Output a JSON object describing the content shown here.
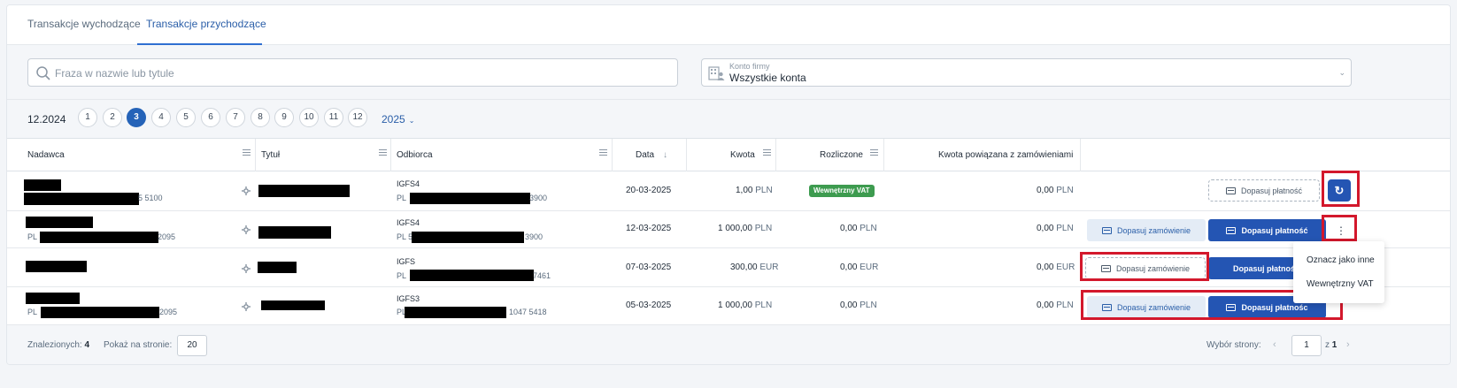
{
  "tabs": [
    {
      "label": "Transakcje wychodzące"
    },
    {
      "label": "Transakcje przychodzące"
    }
  ],
  "search": {
    "placeholder": "Fraza w nazwie lub tytule"
  },
  "account": {
    "label": "Konto firmy",
    "value": "Wszystkie konta"
  },
  "months": {
    "period": "12.2024",
    "items": [
      "1",
      "2",
      "3",
      "4",
      "5",
      "6",
      "7",
      "8",
      "9",
      "10",
      "11",
      "12"
    ],
    "selected": "3",
    "year": "2025"
  },
  "columns": {
    "sender": "Nadawca",
    "title": "Tytuł",
    "recipient": "Odbiorca",
    "date": "Data",
    "amount": "Kwota",
    "settled": "Rozliczone",
    "linked": "Kwota powiązana z zamówieniami"
  },
  "rows": [
    {
      "sender_suffix": "5 5100",
      "recipient_name": "IGFS4",
      "recipient_prefix": "PL",
      "recipient_suffix": "3900",
      "date": "20-03-2025",
      "amount": "1,00",
      "amount_currency": "PLN",
      "settled_badge": "Wewnętrzny VAT",
      "linked": "0,00",
      "linked_currency": "PLN",
      "pay_button": "Dopasuj płatność"
    },
    {
      "sender_prefix": "PL",
      "sender_suffix": "2095",
      "recipient_name": "IGFS4",
      "recipient_prefix": "PL 5",
      "recipient_suffix": "3900",
      "date": "12-03-2025",
      "amount": "1 000,00",
      "amount_currency": "PLN",
      "settled": "0,00",
      "settled_currency": "PLN",
      "linked": "0,00",
      "linked_currency": "PLN",
      "order_button": "Dopasuj zamówienie",
      "pay_button": "Dopasuj płatność"
    },
    {
      "recipient_name": "IGFS",
      "recipient_prefix": "PL",
      "recipient_suffix": "7461",
      "date": "07-03-2025",
      "amount": "300,00",
      "amount_currency": "EUR",
      "settled": "0,00",
      "settled_currency": "EUR",
      "linked": "0,00",
      "linked_currency": "EUR",
      "order_button": "Dopasuj zamówienie",
      "pay_button": "Dopasuj płatnoś"
    },
    {
      "sender_prefix": "PL",
      "sender_suffix": "2095",
      "recipient_name": "IGFS3",
      "recipient_prefix": "PL",
      "recipient_suffix": "1047 5418",
      "date": "05-03-2025",
      "amount": "1 000,00",
      "amount_currency": "PLN",
      "settled": "0,00",
      "settled_currency": "PLN",
      "linked": "0,00",
      "linked_currency": "PLN",
      "order_button": "Dopasuj zamówienie",
      "pay_button": "Dopasuj płatnośc"
    }
  ],
  "dropdown": {
    "items": [
      "Oznacz jako inne",
      "Wewnętrzny VAT"
    ]
  },
  "footer": {
    "found_label": "Znalezionych:",
    "found_count": "4",
    "per_page_label": "Pokaż na stronie:",
    "per_page_value": "20",
    "page_select_label": "Wybór strony:",
    "current_page": "1",
    "of_label": "z",
    "total_pages": "1"
  },
  "icons": {
    "refresh": "refresh-icon",
    "more": "more-vertical-icon",
    "gear": "settings-icon",
    "search": "search-icon",
    "building": "building-user-icon",
    "card": "payment-card-icon"
  },
  "colors": {
    "primary": "#2455b3",
    "accent_light": "#e4ecf6",
    "badge_green": "#3d9b4f",
    "highlight_red": "#d3182c"
  }
}
